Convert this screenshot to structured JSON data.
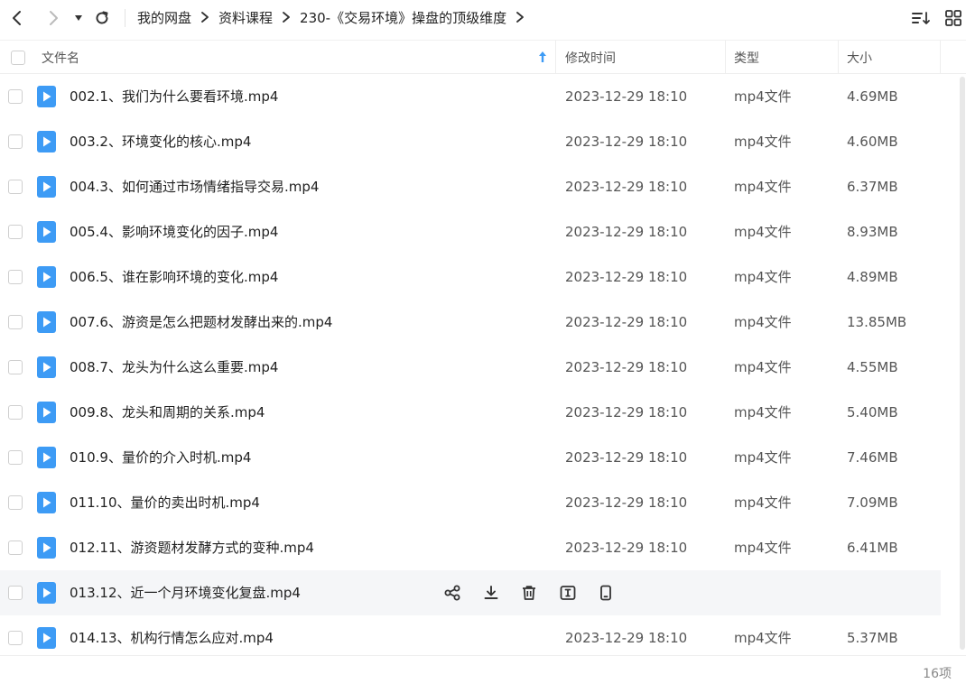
{
  "nav": {
    "breadcrumb": [
      "我的网盘",
      "资料课程",
      "230-《交易环境》操盘的顶级维度"
    ]
  },
  "header": {
    "name": "文件名",
    "time": "修改时间",
    "type": "类型",
    "size": "大小"
  },
  "files": [
    {
      "name": "002.1、我们为什么要看环境.mp4",
      "time": "2023-12-29 18:10",
      "type": "mp4文件",
      "size": "4.69MB"
    },
    {
      "name": "003.2、环境变化的核心.mp4",
      "time": "2023-12-29 18:10",
      "type": "mp4文件",
      "size": "4.60MB"
    },
    {
      "name": "004.3、如何通过市场情绪指导交易.mp4",
      "time": "2023-12-29 18:10",
      "type": "mp4文件",
      "size": "6.37MB"
    },
    {
      "name": "005.4、影响环境变化的因子.mp4",
      "time": "2023-12-29 18:10",
      "type": "mp4文件",
      "size": "8.93MB"
    },
    {
      "name": "006.5、谁在影响环境的变化.mp4",
      "time": "2023-12-29 18:10",
      "type": "mp4文件",
      "size": "4.89MB"
    },
    {
      "name": "007.6、游资是怎么把题材发酵出来的.mp4",
      "time": "2023-12-29 18:10",
      "type": "mp4文件",
      "size": "13.85MB"
    },
    {
      "name": "008.7、龙头为什么这么重要.mp4",
      "time": "2023-12-29 18:10",
      "type": "mp4文件",
      "size": "4.55MB"
    },
    {
      "name": "009.8、龙头和周期的关系.mp4",
      "time": "2023-12-29 18:10",
      "type": "mp4文件",
      "size": "5.40MB"
    },
    {
      "name": "010.9、量价的介入时机.mp4",
      "time": "2023-12-29 18:10",
      "type": "mp4文件",
      "size": "7.46MB"
    },
    {
      "name": "011.10、量价的卖出时机.mp4",
      "time": "2023-12-29 18:10",
      "type": "mp4文件",
      "size": "7.09MB"
    },
    {
      "name": "012.11、游资题材发酵方式的变种.mp4",
      "time": "2023-12-29 18:10",
      "type": "mp4文件",
      "size": "6.41MB"
    },
    {
      "name": "013.12、近一个月环境变化复盘.mp4",
      "time": "",
      "type": "",
      "size": "",
      "hovered": true
    },
    {
      "name": "014.13、机构行情怎么应对.mp4",
      "time": "2023-12-29 18:10",
      "type": "mp4文件",
      "size": "5.37MB"
    }
  ],
  "row_actions": [
    "share-icon",
    "download-icon",
    "delete-icon",
    "rename-icon",
    "phone-icon"
  ],
  "footer": {
    "count": "16项"
  },
  "colors": {
    "file_icon": "#3d9bf5",
    "hover_row": "#f5f6f8"
  }
}
